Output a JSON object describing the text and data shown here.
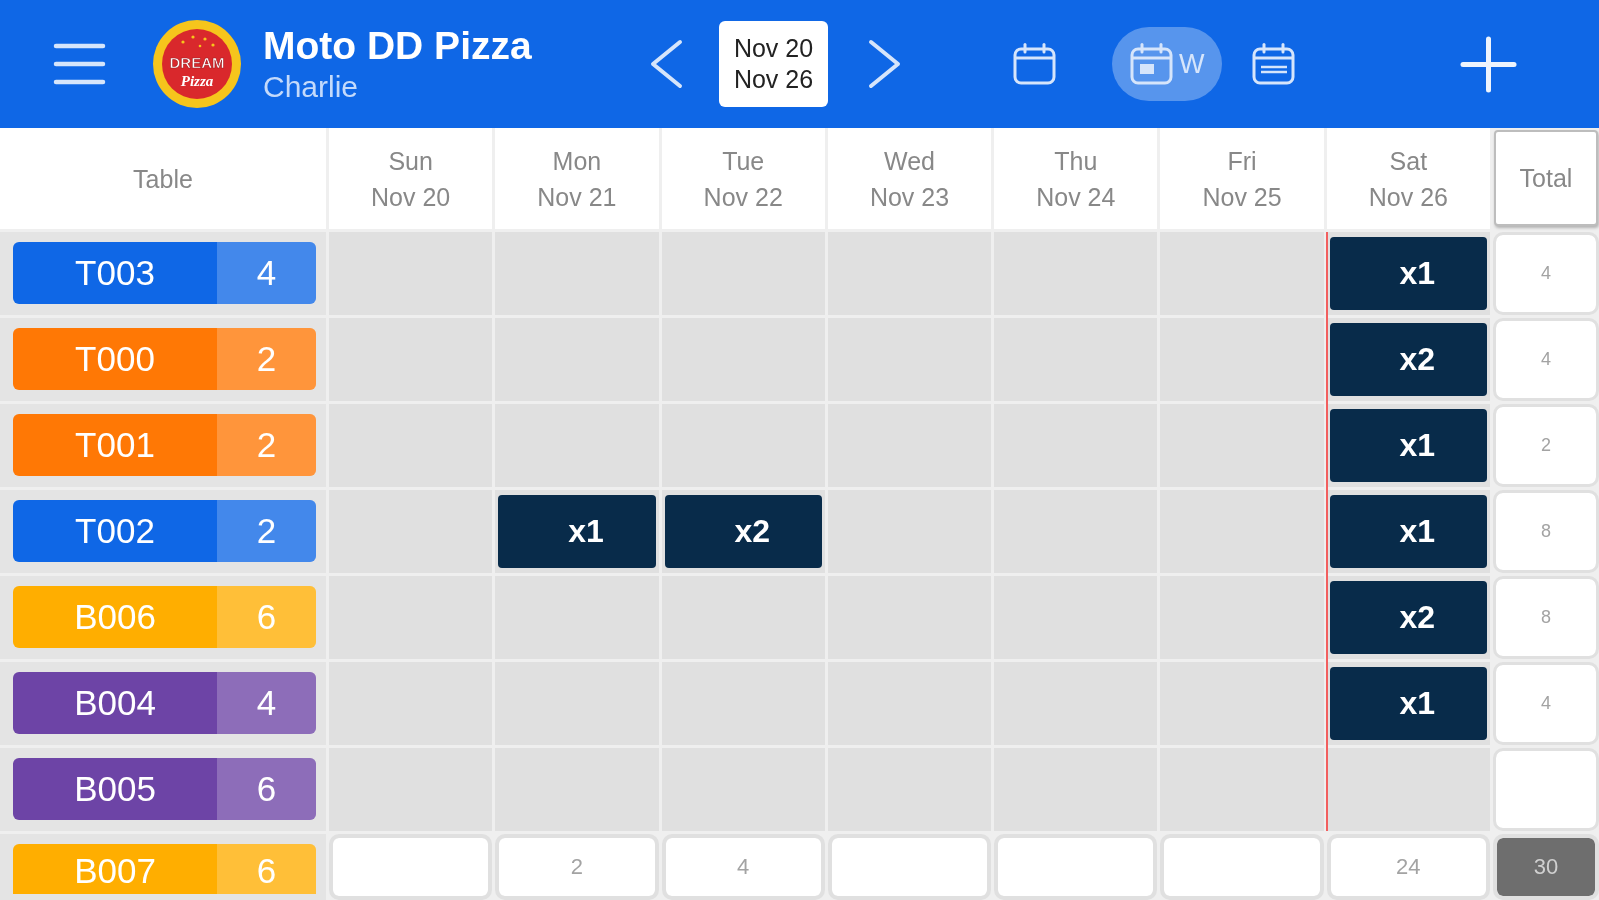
{
  "header": {
    "logo": {
      "line_1": "DREAM",
      "line_2": "Pizza"
    },
    "title": "Moto DD Pizza",
    "subtitle": "Charlie",
    "date_range": {
      "start": "Nov 20",
      "end": "Nov 26"
    },
    "views": [
      {
        "kind": "day",
        "selected": false
      },
      {
        "kind": "week",
        "label": "W",
        "selected": true
      },
      {
        "kind": "month",
        "selected": false
      }
    ]
  },
  "table": {
    "table_heading": "Table",
    "total_heading": "Total",
    "days": [
      {
        "weekday": "Sun",
        "date": "Nov 20",
        "today": false
      },
      {
        "weekday": "Mon",
        "date": "Nov 21",
        "today": false
      },
      {
        "weekday": "Tue",
        "date": "Nov 22",
        "today": false
      },
      {
        "weekday": "Wed",
        "date": "Nov 23",
        "today": false
      },
      {
        "weekday": "Thu",
        "date": "Nov 24",
        "today": false
      },
      {
        "weekday": "Fri",
        "date": "Nov 25",
        "today": false
      },
      {
        "weekday": "Sat",
        "date": "Nov 26",
        "today": true
      }
    ],
    "rows": [
      {
        "table": "T003",
        "seats": "4",
        "color": "#0f67e6",
        "cells": [
          {
            "kind": "empty"
          },
          {
            "kind": "empty"
          },
          {
            "kind": "empty"
          },
          {
            "kind": "empty"
          },
          {
            "kind": "empty"
          },
          {
            "kind": "empty"
          },
          {
            "kind": "booking",
            "label": "x1"
          }
        ],
        "total": "4"
      },
      {
        "table": "T000",
        "seats": "2",
        "color": "#ff7805",
        "cells": [
          {
            "kind": "empty"
          },
          {
            "kind": "empty"
          },
          {
            "kind": "empty"
          },
          {
            "kind": "empty"
          },
          {
            "kind": "empty"
          },
          {
            "kind": "empty"
          },
          {
            "kind": "booking",
            "label": "x2"
          }
        ],
        "total": "4"
      },
      {
        "table": "T001",
        "seats": "2",
        "color": "#ff7805",
        "cells": [
          {
            "kind": "empty"
          },
          {
            "kind": "empty"
          },
          {
            "kind": "empty"
          },
          {
            "kind": "empty"
          },
          {
            "kind": "empty"
          },
          {
            "kind": "empty"
          },
          {
            "kind": "booking",
            "label": "x1"
          }
        ],
        "total": "2"
      },
      {
        "table": "T002",
        "seats": "2",
        "color": "#0f67e6",
        "cells": [
          {
            "kind": "empty"
          },
          {
            "kind": "booking",
            "label": "x1"
          },
          {
            "kind": "booking",
            "label": "x2"
          },
          {
            "kind": "empty"
          },
          {
            "kind": "empty"
          },
          {
            "kind": "empty"
          },
          {
            "kind": "booking",
            "label": "x1"
          }
        ],
        "total": "8"
      },
      {
        "table": "B006",
        "seats": "6",
        "color": "#ffae00",
        "cells": [
          {
            "kind": "empty"
          },
          {
            "kind": "empty"
          },
          {
            "kind": "empty"
          },
          {
            "kind": "empty"
          },
          {
            "kind": "empty"
          },
          {
            "kind": "empty"
          },
          {
            "kind": "booking",
            "label": "x2"
          }
        ],
        "total": "8"
      },
      {
        "table": "B004",
        "seats": "4",
        "color": "#6d44a6",
        "cells": [
          {
            "kind": "empty"
          },
          {
            "kind": "empty"
          },
          {
            "kind": "empty"
          },
          {
            "kind": "empty"
          },
          {
            "kind": "empty"
          },
          {
            "kind": "empty"
          },
          {
            "kind": "booking",
            "label": "x1"
          }
        ],
        "total": "4"
      },
      {
        "table": "B005",
        "seats": "6",
        "color": "#6d44a6",
        "cells": [
          {
            "kind": "empty"
          },
          {
            "kind": "empty"
          },
          {
            "kind": "empty"
          },
          {
            "kind": "empty"
          },
          {
            "kind": "empty"
          },
          {
            "kind": "empty"
          },
          {
            "kind": "empty"
          }
        ]
      }
    ],
    "partially_visible_row": {
      "table": "B007",
      "seats": "6",
      "color": "#ffae00"
    },
    "day_totals": [
      {
        "kind": "empty"
      },
      {
        "kind": "value",
        "value": "2"
      },
      {
        "kind": "value",
        "value": "4"
      },
      {
        "kind": "empty"
      },
      {
        "kind": "empty"
      },
      {
        "kind": "empty"
      },
      {
        "kind": "value",
        "value": "24"
      }
    ],
    "grand_total": "30"
  }
}
